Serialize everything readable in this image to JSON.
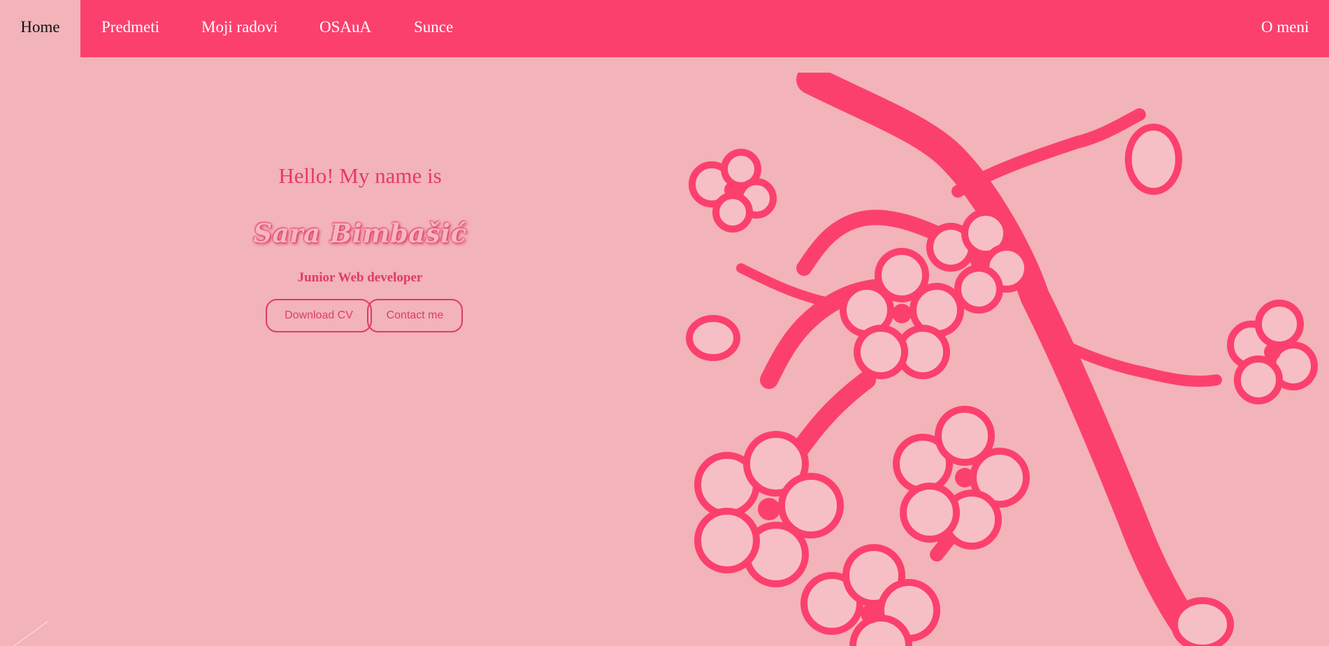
{
  "nav": {
    "home": "Home",
    "items": [
      "Predmeti",
      "Moji radovi",
      "OSAuA",
      "Sunce"
    ],
    "right": "O meni"
  },
  "hero": {
    "greeting": "Hello! My name is",
    "name": "Sara Bimbašić",
    "role": "Junior Web developer",
    "download_cv": "Download CV",
    "contact_me": "Contact me"
  },
  "colors": {
    "nav_bg": "#fc406d",
    "page_bg": "#f2b3b9",
    "accent": "#e03a68",
    "blossom": "#fc406d"
  },
  "icons": {
    "illustration": "cherry-blossom-branch"
  }
}
